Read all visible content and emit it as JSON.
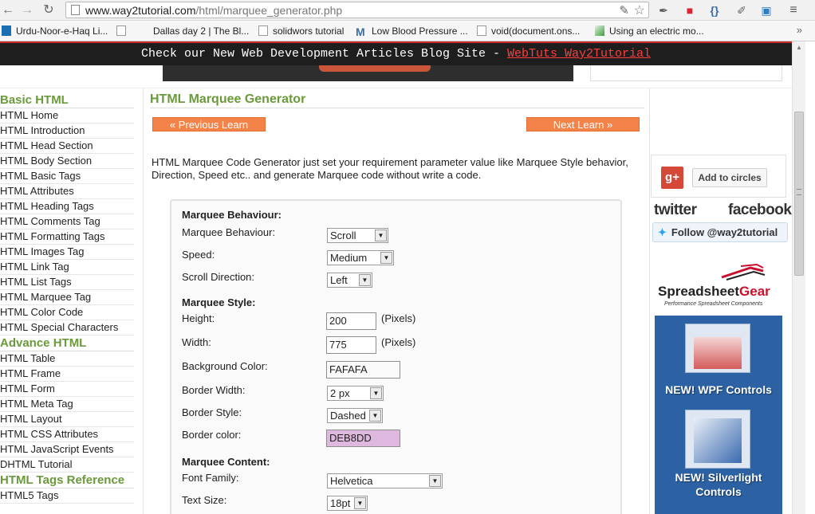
{
  "browser": {
    "url_host": "www.way2tutorial.com",
    "url_path": "/html/marquee_generator.php",
    "bookmarks": [
      "Urdu-Noor-e-Haq Li...",
      "Dallas day 2 | The Bl...",
      "solidwors tutorial",
      "Low Blood Pressure ...",
      "void(document.ons...",
      "Using an electric mo..."
    ],
    "bookmarks_more": "»"
  },
  "banner": {
    "text": "Check our New Web Development Articles Blog Site - ",
    "link": "WebTuts Way2Tutorial"
  },
  "sidebar": {
    "sections": [
      {
        "heading": "Basic HTML",
        "items": [
          "HTML Home",
          "HTML Introduction",
          "HTML Head Section",
          "HTML Body Section",
          "HTML Basic Tags",
          "HTML Attributes",
          "HTML Heading Tags",
          "HTML Comments Tag",
          "HTML Formatting Tags",
          "HTML Images Tag",
          "HTML Link Tag",
          "HTML List Tags",
          "HTML Marquee Tag",
          "HTML Color Code",
          "HTML Special Characters"
        ]
      },
      {
        "heading": "Advance HTML",
        "items": [
          "HTML Table",
          "HTML Frame",
          "HTML Form",
          "HTML Meta Tag",
          "HTML Layout",
          "HTML CSS Attributes",
          "HTML JavaScript Events",
          "DHTML Tutorial"
        ]
      },
      {
        "heading": "HTML Tags Reference",
        "items": [
          "HTML5 Tags"
        ]
      }
    ]
  },
  "main": {
    "title": "HTML Marquee Generator",
    "prev_label": "« Previous Learn",
    "next_label": "Next Learn »",
    "intro": "HTML Marquee Code Generator just set your requirement parameter value like Marquee Style behavior, Direction, Speed etc.. and generate Marquee code without write a code."
  },
  "form": {
    "section_behaviour": "Marquee Behaviour:",
    "behaviour_label": "Marquee Behaviour:",
    "behaviour_value": "Scroll",
    "speed_label": "Speed:",
    "speed_value": "Medium",
    "direction_label": "Scroll Direction:",
    "direction_value": "Left",
    "section_style": "Marquee Style:",
    "height_label": "Height:",
    "height_value": "200",
    "width_label": "Width:",
    "width_value": "775",
    "pixels_unit": "(Pixels)",
    "bgcolor_label": "Background Color:",
    "bgcolor_value": "FAFAFA",
    "border_width_label": "Border Width:",
    "border_width_value": "2 px",
    "border_style_label": "Border Style:",
    "border_style_value": "Dashed",
    "border_color_label": "Border color:",
    "border_color_value": "DEB8DD",
    "section_content": "Marquee Content:",
    "font_family_label": "Font Family:",
    "font_family_value": "Helvetica",
    "text_size_label": "Text Size:",
    "text_size_value": "18pt"
  },
  "right": {
    "gplus": "g+",
    "add_circles": "Add to circles",
    "twitter": "twitter",
    "facebook": "facebook",
    "follow": "Follow @way2tutorial",
    "ad_brand_a": "Spreadsheet",
    "ad_brand_b": "Gear",
    "ad_tagline": "Performance Spreadsheet Components",
    "ad_line1": "NEW! WPF Controls",
    "ad_line2a": "NEW! Silverlight",
    "ad_line2b": "Controls"
  },
  "colors": {
    "accent_green": "#6a9a3a",
    "button_orange": "#f4834a",
    "banner_link": "#ff3d3d",
    "bgcolor_swatch": "#fafafa",
    "border_color_swatch": "#deb8dd"
  }
}
